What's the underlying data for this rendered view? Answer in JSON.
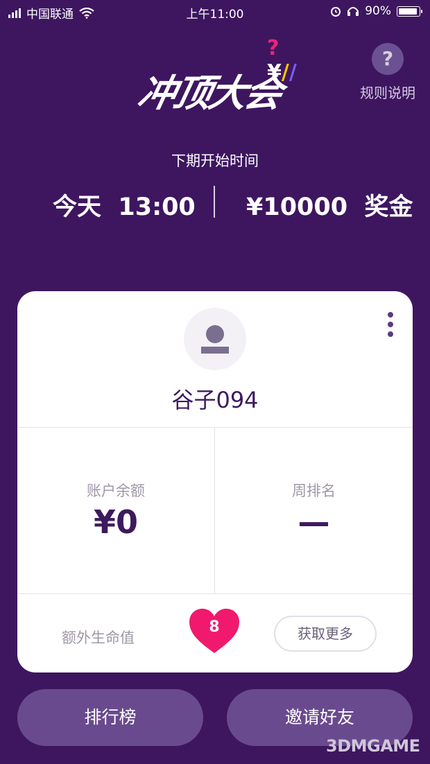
{
  "status_bar": {
    "carrier": "中国联通",
    "time": "上午11:00",
    "battery_text": "90%",
    "icons": [
      "signal-icon",
      "wifi-icon",
      "alarm-icon",
      "headphones-icon",
      "battery-icon"
    ]
  },
  "header": {
    "logo_text": "冲顶大会",
    "logo_deco": "?¥",
    "rules": {
      "icon": "?",
      "label": "规则说明"
    }
  },
  "next_game": {
    "label": "下期开始时间",
    "time": "今天  13:00",
    "prize": "¥10000  奖金"
  },
  "profile": {
    "username": "谷子094",
    "balance_label": "账户余额",
    "balance_value": "¥0",
    "rank_label": "周排名",
    "rank_value": "—",
    "extra_lives_label": "额外生命值",
    "extra_lives_count": "8",
    "get_more_label": "获取更多"
  },
  "bottom": {
    "leaderboard_label": "排行榜",
    "invite_label": "邀请好友"
  },
  "watermark": "3DMGAME",
  "colors": {
    "background": "#3e1660",
    "card": "#ffffff",
    "accent_text": "#3d1a5e",
    "heart": "#f0196e",
    "button": "#6a4a8e"
  }
}
